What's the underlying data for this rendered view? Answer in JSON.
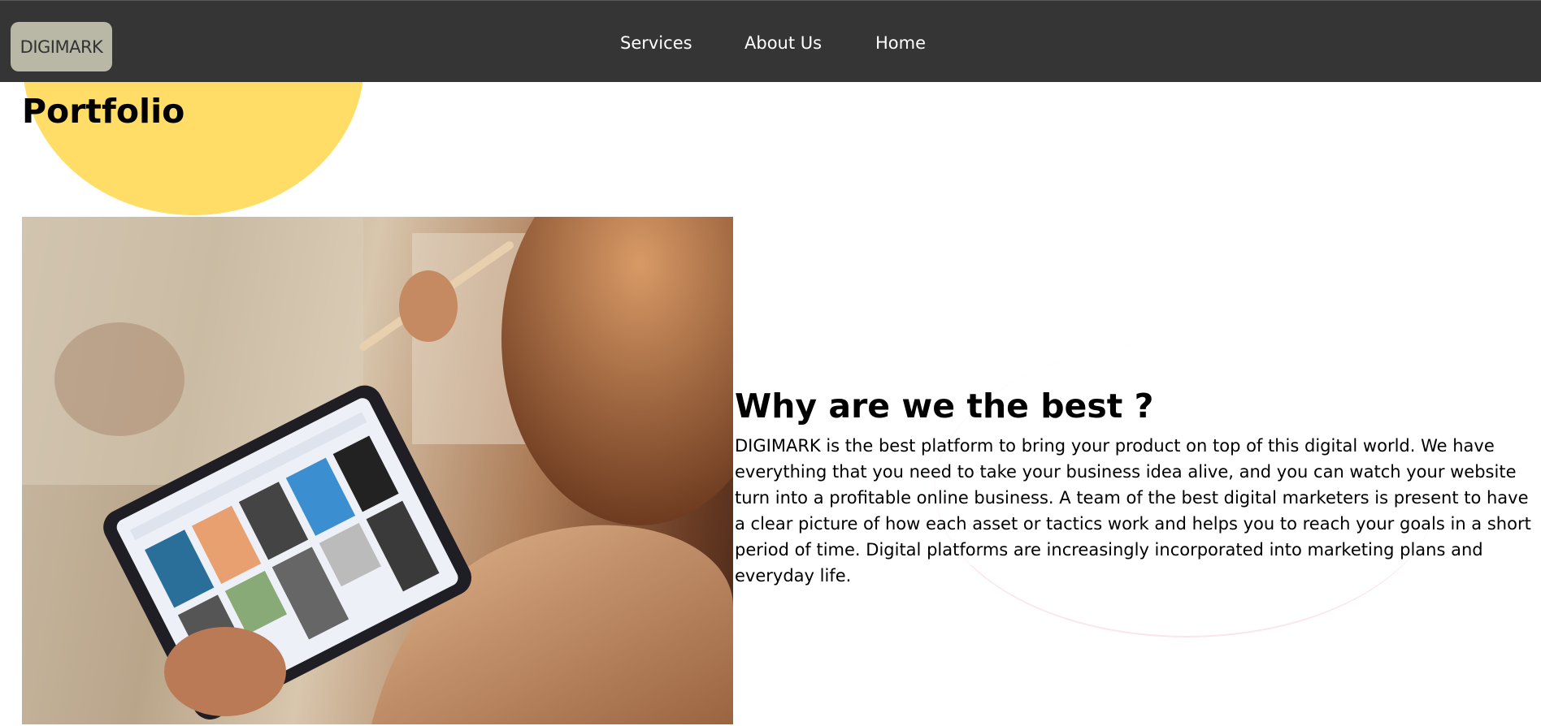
{
  "navbar": {
    "logo": "DIGIMARK",
    "links": [
      {
        "label": "Services"
      },
      {
        "label": "About Us"
      },
      {
        "label": "Home"
      }
    ]
  },
  "portfolio": {
    "title": "Portfolio"
  },
  "hero_image": {
    "alt": "Woman using a tablet with a stylus showing a design template app"
  },
  "about": {
    "headline": "Why are we the best ?",
    "text": "DIGIMARK is the best platform to bring your product on top of this digital world. We have everything that you need to take your business idea alive, and you can watch your website turn into a profitable online business. A team of the best digital marketers is present to have a clear picture of how each asset or tactics work and helps you to reach your goals in a short period of time. Digital platforms are increasingly incorporated into marketing plans and everyday life."
  },
  "colors": {
    "navbar_bg": "#353535",
    "logo_bg": "#b9b8a6",
    "accent_circle": "#ffdd66"
  }
}
